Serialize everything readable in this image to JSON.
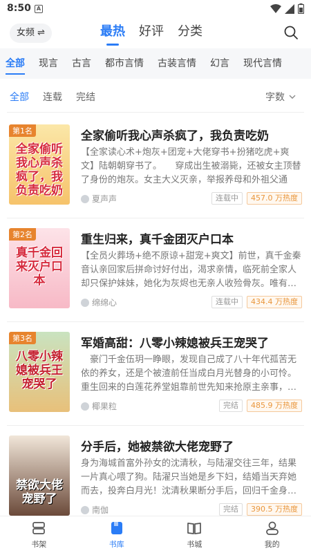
{
  "status": {
    "time": "8:50",
    "notif": "A"
  },
  "header": {
    "channel": "女频",
    "channel_arrow": "⇌",
    "tabs": [
      {
        "label": "最热"
      },
      {
        "label": "好评"
      },
      {
        "label": "分类"
      }
    ]
  },
  "categories": [
    "全部",
    "现言",
    "古言",
    "都市言情",
    "古装言情",
    "幻言",
    "现代言情"
  ],
  "filters": [
    "全部",
    "连载",
    "完结"
  ],
  "sort": "字数",
  "books": [
    {
      "rank": "第1名",
      "cover_text": "全家偷听我心声杀疯了，我负责吃奶",
      "cover_colors": [
        "#fbe7a8",
        "#f6c36b"
      ],
      "title": "全家偷听我心声杀疯了，我负责吃奶",
      "desc": "【全家读心术+炮灰+团宠+大佬穿书+扮猪吃虎+爽文】陆朝朝穿书了。　　穿成出生被溺毙，还被女主顶替了身份的炮灰。女主大义灭亲，举报养母和外祖父通敌…",
      "author": "夏声声",
      "status": "连载中",
      "heat": "457.0 万热度"
    },
    {
      "rank": "第2名",
      "cover_text": "真千金回来灭户口本",
      "cover_colors": [
        "#fde3e8",
        "#f7b9c6"
      ],
      "title": "重生归来，真千金团灭户口本",
      "desc": "【全员火葬场+绝不原谅+甜宠+爽文】前世，真千金秦音认亲回家后拼命讨好付出，渴求亲情，临死前全家人却只保护妹妹，她化为灰烬也无亲人收殓骨灰。唯有…",
      "author": "绵绵心",
      "status": "连载中",
      "heat": "434.4 万热度"
    },
    {
      "rank": "第3名",
      "cover_text": "八零小辣媳被兵王宠哭了",
      "cover_colors": [
        "#c9e3c0",
        "#e8c07a"
      ],
      "title": "军婚高甜：八零小辣媳被兵王宠哭了",
      "desc": "　豪门千金伍玥一睁眼，发现自己成了八十年代孤苦无依的养女，还是个被渣前任当成白月光替身的小可怜。重生回来的白莲花养堂姐靠前世先知来抢原主亲事，…",
      "author": "椰果粒",
      "status": "完结",
      "heat": "485.9 万热度"
    },
    {
      "rank": "",
      "cover_text": "禁欲大佬宠野了",
      "cover_colors": [
        "#f1e6d9",
        "#6b4a3a"
      ],
      "title": "分手后，她被禁欲大佬宠野了",
      "desc": "身为海城首富外孙女的沈清秋，与陆濯交往三年，结果一片真心喂了狗。陆濯只当她是乡下妇，结婚当天弃她而去，投奔白月光！沈清秋果断分手后，回归千金身…",
      "author": "南伽",
      "status": "完结",
      "heat": "390.5 万热度"
    }
  ],
  "bottom_nav": [
    {
      "label": "书架",
      "icon": "bookshelf-icon"
    },
    {
      "label": "书库",
      "icon": "library-icon"
    },
    {
      "label": "书城",
      "icon": "bookstore-icon"
    },
    {
      "label": "我的",
      "icon": "profile-icon"
    }
  ],
  "colors": {
    "accent": "#2a7cf6",
    "heat": "#e9963c",
    "rank": "#e7842e"
  }
}
